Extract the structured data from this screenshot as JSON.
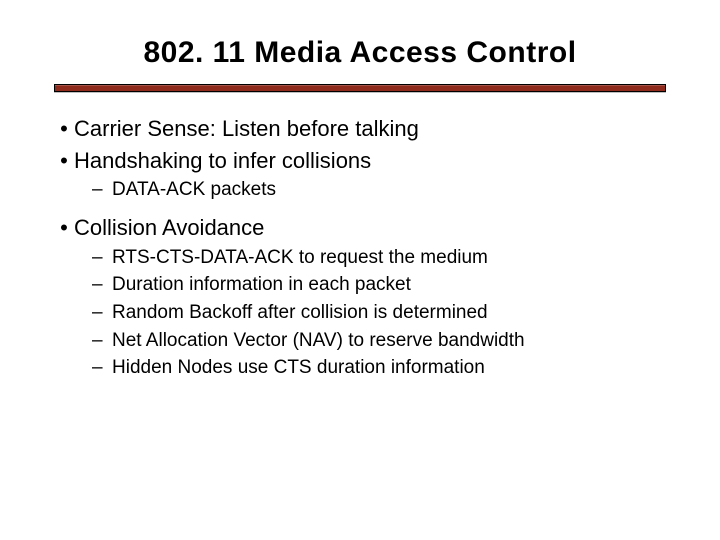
{
  "title": "802. 11 Media Access Control",
  "items": [
    {
      "text": "Carrier Sense:  Listen before talking",
      "sub": []
    },
    {
      "text": "Handshaking to infer collisions",
      "sub": [
        "DATA-ACK packets"
      ]
    },
    {
      "text": "Collision Avoidance",
      "sub": [
        "RTS-CTS-DATA-ACK to request the medium",
        "Duration information in each packet",
        "Random Backoff after collision is determined",
        "Net Allocation Vector (NAV) to reserve bandwidth",
        "Hidden Nodes use CTS duration information"
      ]
    }
  ]
}
